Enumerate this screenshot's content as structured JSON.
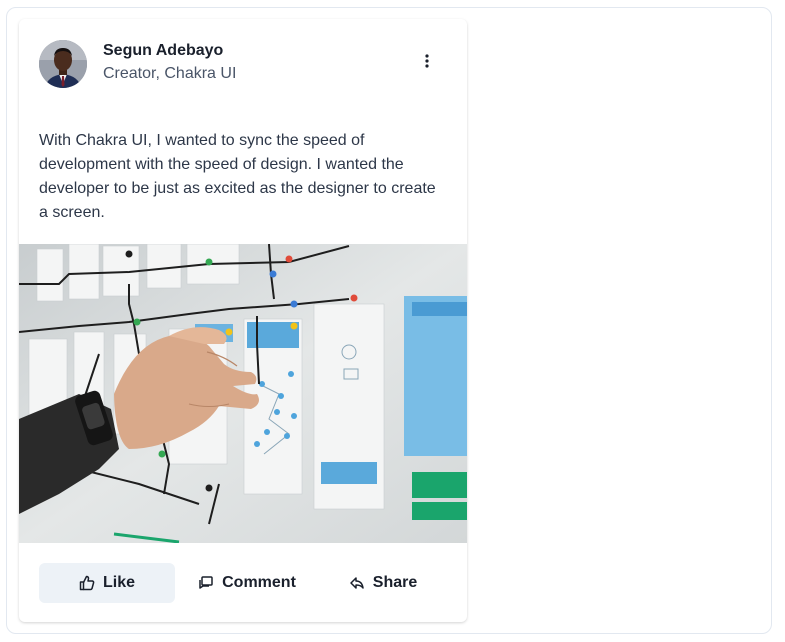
{
  "card": {
    "author": {
      "name": "Segun Adebayo",
      "role": "Creator, Chakra UI"
    },
    "menu_icon": "three-dots-vertical-icon",
    "body": "With Chakra UI, I wanted to sync the speed of development with the speed of design. I wanted the developer to be just as excited as the designer to create a screen.",
    "image": "photo-of-hand-arranging-wireframe-sketches-on-wall",
    "actions": [
      {
        "label": "Like",
        "icon": "thumbs-up-icon"
      },
      {
        "label": "Comment",
        "icon": "chat-bubble-icon"
      },
      {
        "label": "Share",
        "icon": "share-reply-icon"
      }
    ]
  },
  "colors": {
    "like_button_bg": "#edf2f7",
    "text_primary": "#1a202c",
    "text_secondary": "#4a5568"
  }
}
